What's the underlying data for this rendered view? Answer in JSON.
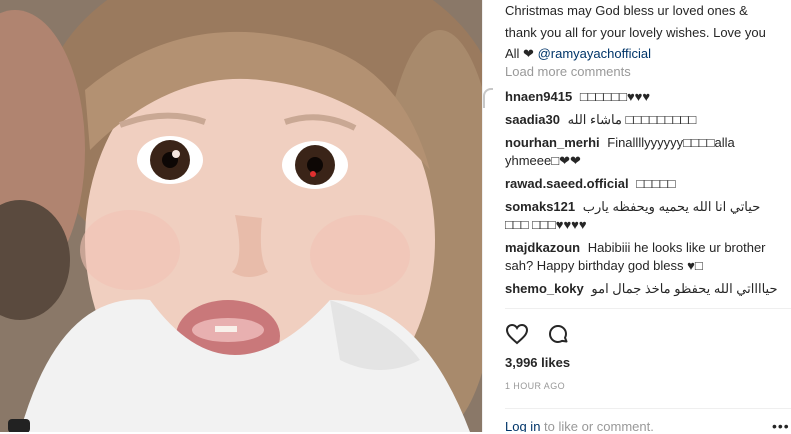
{
  "post": {
    "caption_text": "Christmas may God bless ur loved ones & thank you all for your lovely wishes. Love you All ❤ ",
    "caption_mention": "@ramyayachofficial",
    "load_more": "Load more comments",
    "likes": "3,996 likes",
    "time": "1 HOUR AGO",
    "login_link": "Log in",
    "login_text": " to like or comment."
  },
  "comments": [
    {
      "user": "hnaen9415",
      "text": "□□□□□□♥♥♥"
    },
    {
      "user": "saadia30",
      "text": "ماشاء الله □□□□□□□□□"
    },
    {
      "user": "nourhan_merhi",
      "text": "Finallllyyyyyy□□□□alla yhmeee□❤❤"
    },
    {
      "user": "rawad.saeed.official",
      "text": "□□□□□"
    },
    {
      "user": "somaks121",
      "text": "حياتي انا الله يحميه ويحفظه يارب □□□ □□□♥♥♥♥"
    },
    {
      "user": "majdkazoun",
      "text": "Habibiii he looks like ur brother sah? Happy birthday god bless ♥□"
    },
    {
      "user": "shemo_koky",
      "text": "حيااااتي الله يحفظو ماخذ جمال امو"
    }
  ],
  "icons": {
    "like": "heart-outline",
    "comment": "speech-bubble",
    "more": "more-dots"
  },
  "colors": {
    "link": "#003569",
    "muted": "#999999",
    "text": "#262626"
  }
}
